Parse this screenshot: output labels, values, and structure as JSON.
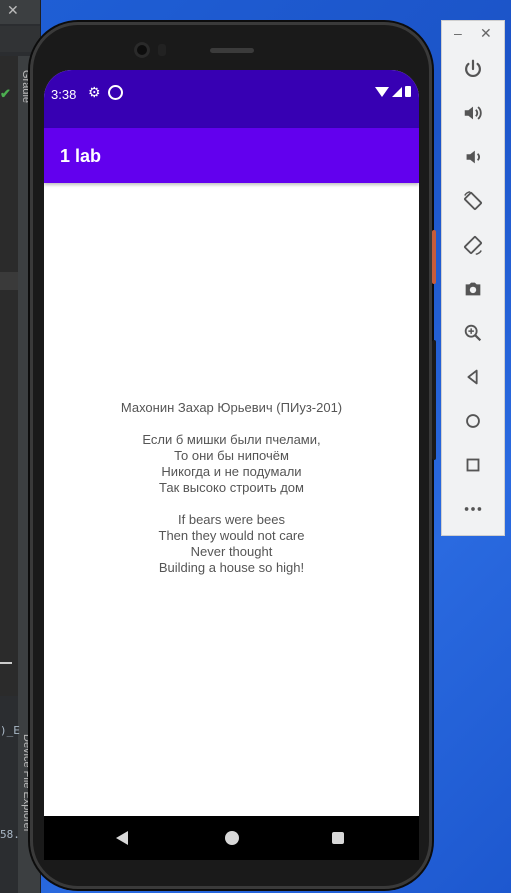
{
  "ide": {
    "close_glyph": "✕",
    "side_label_top": "Gradle",
    "side_label_bottom": "Device File Explorer",
    "code_fragment_1": ")_E",
    "code_fragment_2": "58."
  },
  "phone": {
    "status_time": "3:38",
    "app_title": "1 lab",
    "content": {
      "author": "Махонин Захар Юрьевич (ПИуз-201)",
      "poem_ru": [
        "Если б мишки были пчелами,",
        "То они бы нипочём",
        "Никогда и не подумали",
        "Так высоко строить дом"
      ],
      "poem_en": [
        "If bears were bees",
        "Then they would not care",
        "Never thought",
        "Building a house so high!"
      ]
    }
  },
  "emulator": {
    "minimize_glyph": "–",
    "close_glyph": "✕"
  },
  "colors": {
    "status_bar": "#3700b3",
    "app_bar": "#6200ee",
    "desktop": "#1f5fd6"
  }
}
